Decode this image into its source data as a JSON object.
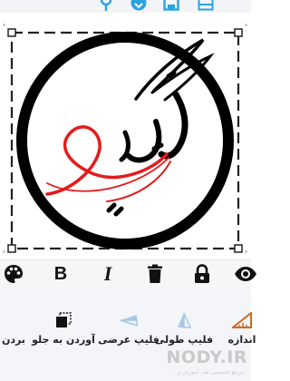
{
  "colors": {
    "accent_blue": "#29a3e0",
    "ring_black": "#000000",
    "script_red": "#e31b1b",
    "toolbar_bg": "#f6f6f6",
    "bottom_bg": "#f3f5f8"
  },
  "top_toolbar": {
    "icons": [
      "pin-icon",
      "share-icon",
      "save-icon",
      "gallery-icon"
    ]
  },
  "canvas": {
    "logo": "circular-ring-with-calligraphy",
    "calligraphy_text": "نگین"
  },
  "edit_toolbar": {
    "icons": [
      "palette-icon",
      "bold-icon",
      "italic-icon",
      "trash-icon",
      "lock-icon",
      "eye-icon"
    ],
    "bold_glyph": "B",
    "italic_glyph": "I"
  },
  "bottom_tools": {
    "items": [
      {
        "icon": "resize-ruler-icon",
        "label": "اندازه"
      },
      {
        "icon": "flip-vertical-icon",
        "label": "فلیپ طولی"
      },
      {
        "icon": "flip-horizontal-icon",
        "label": "فلیپ عرضی"
      },
      {
        "icon": "bring-forward-icon",
        "label": "آوردن به جلو"
      },
      {
        "icon": "send-back-icon",
        "label": "بردن"
      }
    ]
  },
  "watermark": {
    "text": "NODY.IR",
    "subtext": "مرجع تخصصی نقد، آموزش و..."
  }
}
